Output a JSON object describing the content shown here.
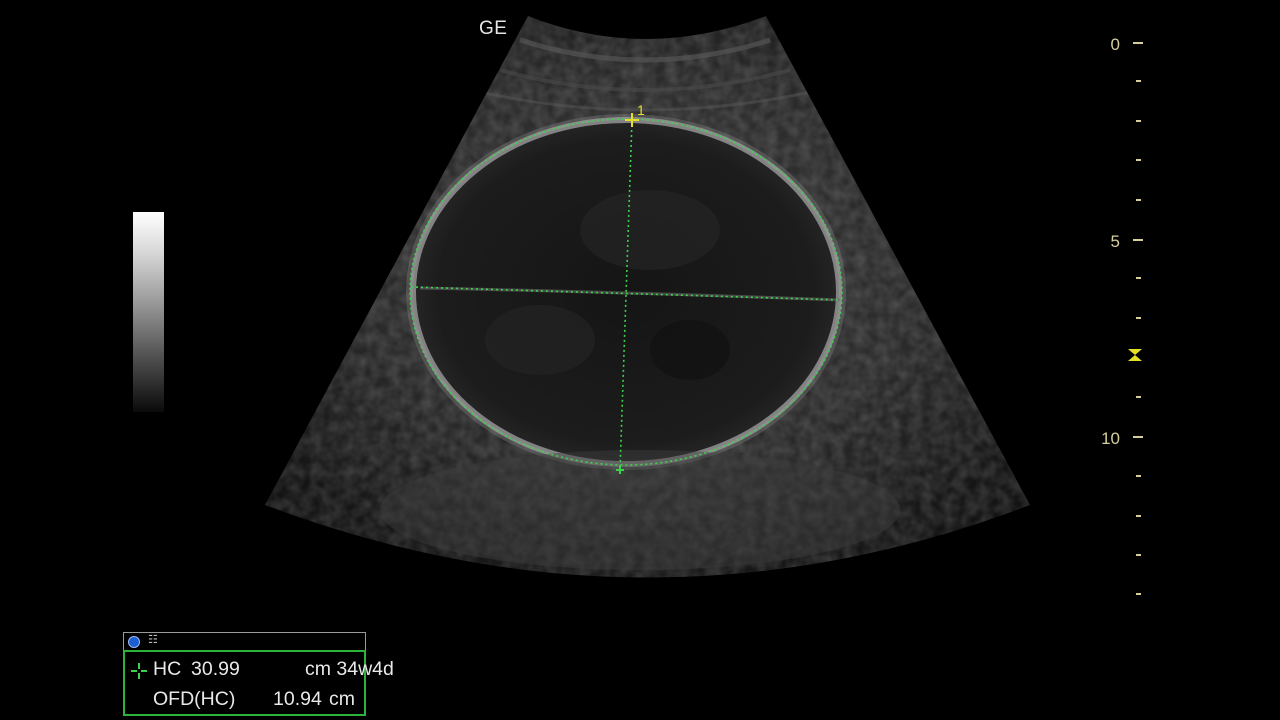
{
  "brand": "GE",
  "depth_scale": {
    "labels": [
      "0",
      "5",
      "10"
    ],
    "color": "#d7cf9a"
  },
  "measurement_colors": {
    "ellipse": "#39d44a",
    "caliper": "#e6df2a"
  },
  "calipers": {
    "marker_label": "1"
  },
  "measurement_panel": {
    "hc_label": "HC",
    "hc_value": "30.99",
    "hc_unit": "cm 34w4d",
    "ofd_label": "OFD(HC)",
    "ofd_value": "10.94",
    "ofd_unit": "cm"
  }
}
